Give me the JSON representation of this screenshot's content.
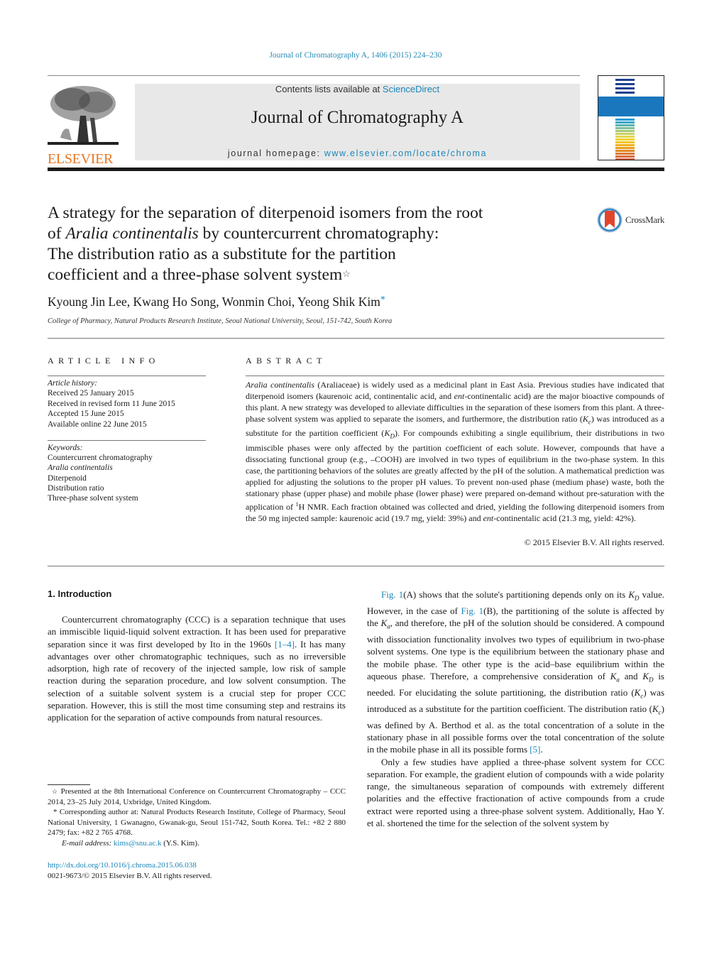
{
  "header": {
    "journal_ref": "Journal of Chromatography A, 1406 (2015) 224–230",
    "contents_prefix": "Contents lists available at ",
    "contents_link": "ScienceDirect",
    "journal_name": "Journal of Chromatography A",
    "homepage_prefix": "journal homepage: ",
    "homepage_link": "www.elsevier.com/locate/chroma",
    "publisher_logo_text": "ELSEVIER",
    "crossmark_label": "CrossMark"
  },
  "article": {
    "title_line1": "A strategy for the separation of diterpenoid isomers from the root",
    "title_line2_pre": "of ",
    "title_line2_italic": "Aralia continentalis",
    "title_line2_post": " by countercurrent chromatography:",
    "title_line3": "The distribution ratio as a substitute for the partition",
    "title_line4": "coefficient and a three-phase solvent system",
    "title_footnote_mark": "☆",
    "authors": "Kyoung Jin Lee, Kwang Ho Song, Wonmin Choi, Yeong Shik Kim",
    "corresponding_mark": "*",
    "affiliation": "College of Pharmacy, Natural Products Research Institute, Seoul National University, Seoul, 151-742, South Korea"
  },
  "article_info": {
    "heading": "ARTICLE INFO",
    "history_label": "Article history:",
    "history": [
      "Received 25 January 2015",
      "Received in revised form 11 June 2015",
      "Accepted 15 June 2015",
      "Available online 22 June 2015"
    ],
    "keywords_label": "Keywords:",
    "keywords": [
      {
        "text": "Countercurrent chromatography",
        "italic": false
      },
      {
        "text": "Aralia continentalis",
        "italic": true
      },
      {
        "text": "Diterpenoid",
        "italic": false
      },
      {
        "text": "Distribution ratio",
        "italic": false
      },
      {
        "text": "Three-phase solvent system",
        "italic": false
      }
    ]
  },
  "abstract": {
    "heading": "ABSTRACT",
    "p1_italic": "Aralia continentalis",
    "p1a": " (Araliaceae) is widely used as a medicinal plant in East Asia. Previous studies have indicated that diterpenoid isomers (kaurenoic acid, continentalic acid, and ",
    "ent": "ent",
    "p1b": "-continentalic acid) are the major bioactive compounds of this plant. A new strategy was developed to alleviate difficulties in the separation of these isomers from this plant. A three-phase solvent system was applied to separate the isomers, and furthermore, the distribution ratio (",
    "kc": "K",
    "kc_sub": "c",
    "p1c": ") was introduced as a substitute for the partition coefficient (",
    "kd": "K",
    "kd_sub": "D",
    "p1d": "). For compounds exhibiting a single equilibrium, their distributions in two immiscible phases were only affected by the partition coefficient of each solute. However, compounds that have a dissociating functional group (e.g., –COOH) are involved in two types of equilibrium in the two-phase system. In this case, the partitioning behaviors of the solutes are greatly affected by the pH of the solution. A mathematical prediction was applied for adjusting the solutions to the proper pH values. To prevent non-used phase (medium phase) waste, both the stationary phase (upper phase) and mobile phase (lower phase) were prepared on-demand without pre-saturation with the application of ",
    "nmr_sup": "1",
    "p1e": "H NMR. Each fraction obtained was collected and dried, yielding the following diterpenoid isomers from the 50 mg injected sample: kaurenoic acid (19.7 mg, yield: 39%) and ",
    "ent2": "ent",
    "p1f": "-continentalic acid (21.3 mg, yield: 42%).",
    "copyright": "© 2015 Elsevier B.V. All rights reserved."
  },
  "introduction": {
    "heading": "1.  Introduction",
    "left_p1a": "Countercurrent chromatography (CCC) is a separation technique that uses an immiscible liquid-liquid solvent extraction. It has been used for preparative separation since it was first developed by Ito in the 1960s ",
    "ref_1_4": "[1–4]",
    "left_p1b": ". It has many advantages over other chromatographic techniques, such as no irreversible adsorption, high rate of recovery of the injected sample, low risk of sample reaction during the separation procedure, and low solvent consumption. The selection of a suitable solvent system is a crucial step for proper CCC separation. However, this is still the most time consuming step and restrains its application for the separation of active compounds from natural resources.",
    "fig_ref": "Fig. 1",
    "right_p1a": "(A) shows that the solute's partitioning depends only on its ",
    "right_p1b": " value. However, in the case of ",
    "right_p1c": "(B), the partitioning of the solute is affected by the ",
    "right_p1d": ", and therefore, the pH of the solution should be considered. A compound with dissociation functionality involves two types of equilibrium in two-phase solvent systems. One type is the equilibrium between the stationary phase and the mobile phase. The other type is the acid–base equilibrium within the aqueous phase. Therefore, a comprehensive consideration of ",
    "right_p1e": " and ",
    "right_p1f": " is needed. For elucidating the solute partitioning, the distribution ratio (",
    "right_p1g": ") was introduced as a substitute for the partition coefficient. The distribution ratio (",
    "right_p1h": ") was defined by A. Berthod et al. as the total concentration of a solute in the stationary phase in all possible forms over the total concentration of the solute in the mobile phase in all its possible forms ",
    "ref_5": "[5]",
    "right_p1i": ".",
    "right_p2": "Only a few studies have applied a three-phase solvent system for CCC separation. For example, the gradient elution of compounds with a wide polarity range, the simultaneous separation of compounds with extremely different polarities and the effective fractionation of active compounds from a crude extract were reported using a three-phase solvent system. Additionally, Hao Y. et al. shortened the time for the selection of the solvent system by",
    "sym_K": "K",
    "sub_D": "D",
    "sub_a": "a",
    "sub_c": "c"
  },
  "footnotes": {
    "star_mark": "☆",
    "star_text": " Presented at the 8th International Conference on Countercurrent Chromatography – CCC 2014, 23–25 July 2014, Uxbridge, United Kingdom.",
    "corr_mark": "*",
    "corr_text": " Corresponding author at: Natural Products Research Institute, College of Pharmacy, Seoul National University, 1 Gwanagno, Gwanak-gu, Seoul 151-742, South Korea. Tel.: +82 2 880 2479; fax: +82 2 765 4768.",
    "email_label": "E-mail address: ",
    "email": "kims@snu.ac.k",
    "email_suffix": " (Y.S. Kim).",
    "doi": "http://dx.doi.org/10.1016/j.chroma.2015.06.038",
    "issn": "0021-9673/© 2015 Elsevier B.V. All rights reserved."
  },
  "colors": {
    "link": "#1a86b8",
    "elsevier_orange": "#e87722",
    "header_gray": "#e8e8e8"
  }
}
